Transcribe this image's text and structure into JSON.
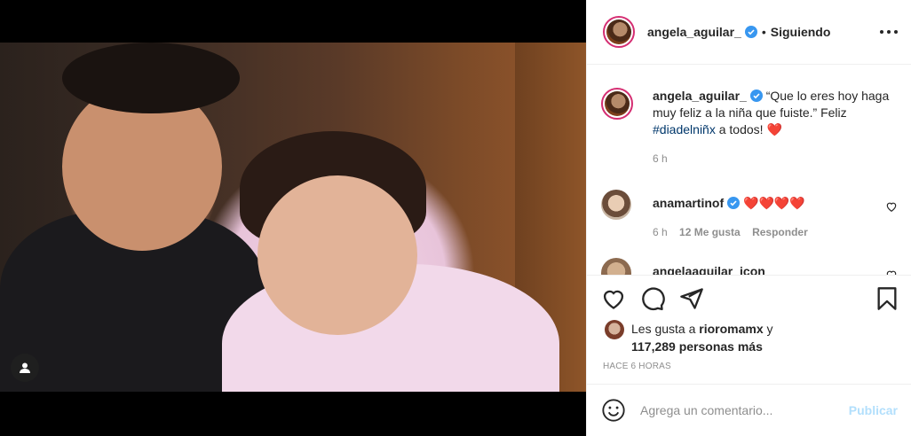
{
  "header": {
    "username": "angela_aguilar_",
    "separator": "•",
    "follow_status": "Siguiendo"
  },
  "caption": {
    "username": "angela_aguilar_",
    "text_part1": "“Que lo eres hoy haga muy feliz a la niña que fuiste.” Feliz ",
    "hashtag": "#diadelniñx",
    "text_part2": " a todos!",
    "emoji": "❤️",
    "time": "6 h"
  },
  "comments": [
    {
      "username": "anamartinof",
      "text": "❤️❤️❤️❤️",
      "time": "6 h",
      "likes": "12 Me gusta",
      "reply": "Responder"
    },
    {
      "username": "angelaaguilar_icon"
    }
  ],
  "likes": {
    "prefix": "Les gusta a ",
    "user": "rioromamx",
    "suffix": " y",
    "count_text": "117,289 personas más"
  },
  "timestamp": "HACE 6 HORAS",
  "comment_box": {
    "placeholder": "Agrega un comentario...",
    "post_label": "Publicar"
  },
  "icons": {
    "verified": "verified-badge-icon",
    "more": "more-options-icon",
    "like": "heart-icon",
    "comment": "comment-icon",
    "share": "paper-plane-icon",
    "save": "bookmark-icon",
    "emoji": "smile-icon",
    "user_tag": "user-tag-icon"
  },
  "colors": {
    "verified": "#3897f0",
    "link": "#00376b",
    "muted": "#8e8e8e",
    "post_disabled": "#b2dffc",
    "story_ring": "#d52e72"
  }
}
